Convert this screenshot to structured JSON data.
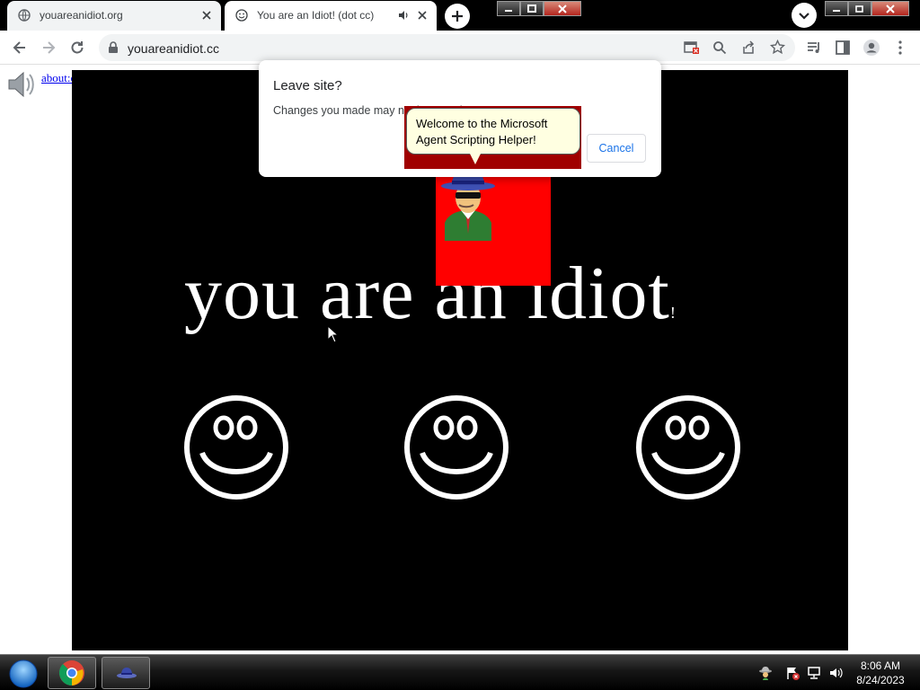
{
  "tabs": [
    {
      "title": "youareanidiot.org"
    },
    {
      "title": "You are an Idiot! (dot cc)"
    }
  ],
  "toolbar": {
    "url": "youareanidiot.cc"
  },
  "page": {
    "about_link": "about:crash.edu",
    "headline": "you are an idiot",
    "headline_suffix": "!"
  },
  "agent": {
    "balloon_text": "Welcome to the Microsoft Agent Scripting Helper!"
  },
  "dialog": {
    "title": "Leave site?",
    "message": "Changes you made may not be saved.",
    "cancel_label": "Cancel"
  },
  "taskbar": {
    "time": "8:06 AM",
    "date": "8/24/2023"
  },
  "colors": {
    "stage_bg": "#000000",
    "agent_bg": "#ff0000",
    "balloon_bg": "#ffffe1",
    "link": "#0000ee",
    "cancel_text": "#1a73e8"
  }
}
